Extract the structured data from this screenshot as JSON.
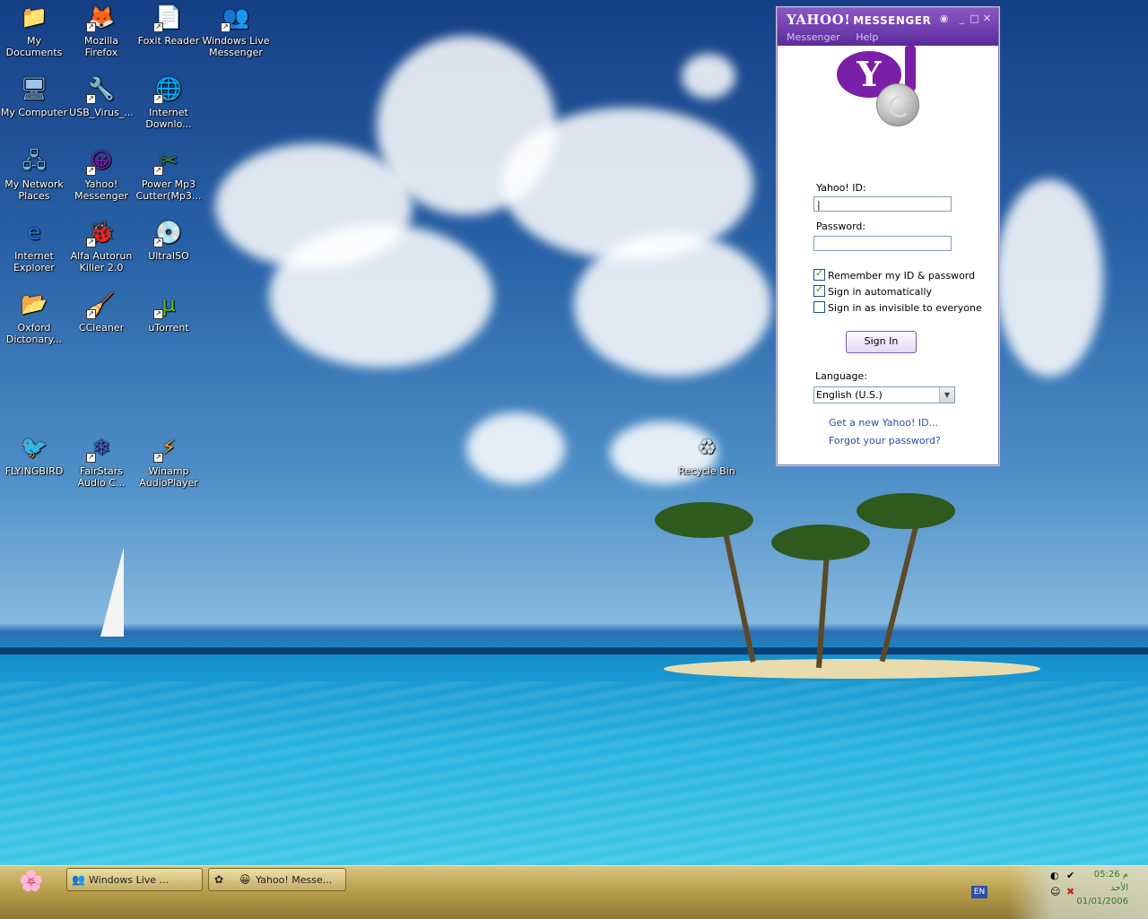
{
  "desktop_icons": [
    {
      "label": "My Documents",
      "glyph": "📁",
      "shortcut": false
    },
    {
      "label": "Mozilla Firefox",
      "glyph": "🦊",
      "shortcut": true
    },
    {
      "label": "Foxit Reader",
      "glyph": "📄",
      "shortcut": true
    },
    {
      "label": "Windows Live Messenger",
      "glyph": "👥",
      "shortcut": true
    },
    {
      "label": "My Computer",
      "glyph": "🖥",
      "shortcut": false
    },
    {
      "label": "USB_Virus_...",
      "glyph": "🔧",
      "shortcut": true
    },
    {
      "label": "Internet Downlo...",
      "glyph": "🌐",
      "shortcut": true
    },
    {
      "label": "My Network Places",
      "glyph": "🖧",
      "shortcut": false
    },
    {
      "label": "Yahoo! Messenger",
      "glyph": "😀",
      "shortcut": true
    },
    {
      "label": "Power Mp3 Cutter(Mp3...",
      "glyph": "✂",
      "shortcut": true
    },
    {
      "label": "Internet Explorer",
      "glyph": "e",
      "shortcut": false
    },
    {
      "label": "Alfa Autorun Killer 2.0",
      "glyph": "🐞",
      "shortcut": true
    },
    {
      "label": "UltraISO",
      "glyph": "💿",
      "shortcut": true
    },
    {
      "label": "Oxford Dictonary...",
      "glyph": "📂",
      "shortcut": false
    },
    {
      "label": "CCleaner",
      "glyph": "🧹",
      "shortcut": true
    },
    {
      "label": "uTorrent",
      "glyph": "µ",
      "shortcut": true
    },
    {
      "label": "FLYINGBIRD",
      "glyph": "🐦",
      "shortcut": false
    },
    {
      "label": "FairStars Audio C...",
      "glyph": "❄",
      "shortcut": true
    },
    {
      "label": "Winamp AudioPlayer",
      "glyph": "⚡",
      "shortcut": true
    },
    {
      "label": "Recycle Bin",
      "glyph": "♻",
      "shortcut": false
    }
  ],
  "messenger": {
    "brand": "YAHOO!",
    "brand_sub": "MESSENGER",
    "menu": [
      "Messenger",
      "Help"
    ],
    "controls": {
      "minimize": "_",
      "maximize": "□",
      "close": "✕"
    },
    "logo_letter": "Y",
    "id_label": "Yahoo! ID:",
    "id_value": "|",
    "password_label": "Password:",
    "password_value": "",
    "checkboxes": [
      {
        "label": "Remember my ID & password",
        "checked": true
      },
      {
        "label": "Sign in automatically",
        "checked": true
      },
      {
        "label": "Sign in as invisible to everyone",
        "checked": false
      }
    ],
    "signin_label": "Sign In",
    "language_label": "Language:",
    "language_value": "English (U.S.)",
    "links": [
      "Get a new Yahoo! ID...",
      "Forgot your password?"
    ]
  },
  "taskbar": {
    "start_glyph": "🌸",
    "buttons": [
      {
        "label": "Windows Live ...",
        "glyph": "👥"
      },
      {
        "label": "Yahoo! Messe...",
        "glyph": "😀"
      }
    ],
    "lang_indicator": "EN",
    "clock_time": "05:26 م",
    "clock_day": "الأحد",
    "clock_date": "01/01/2006"
  }
}
